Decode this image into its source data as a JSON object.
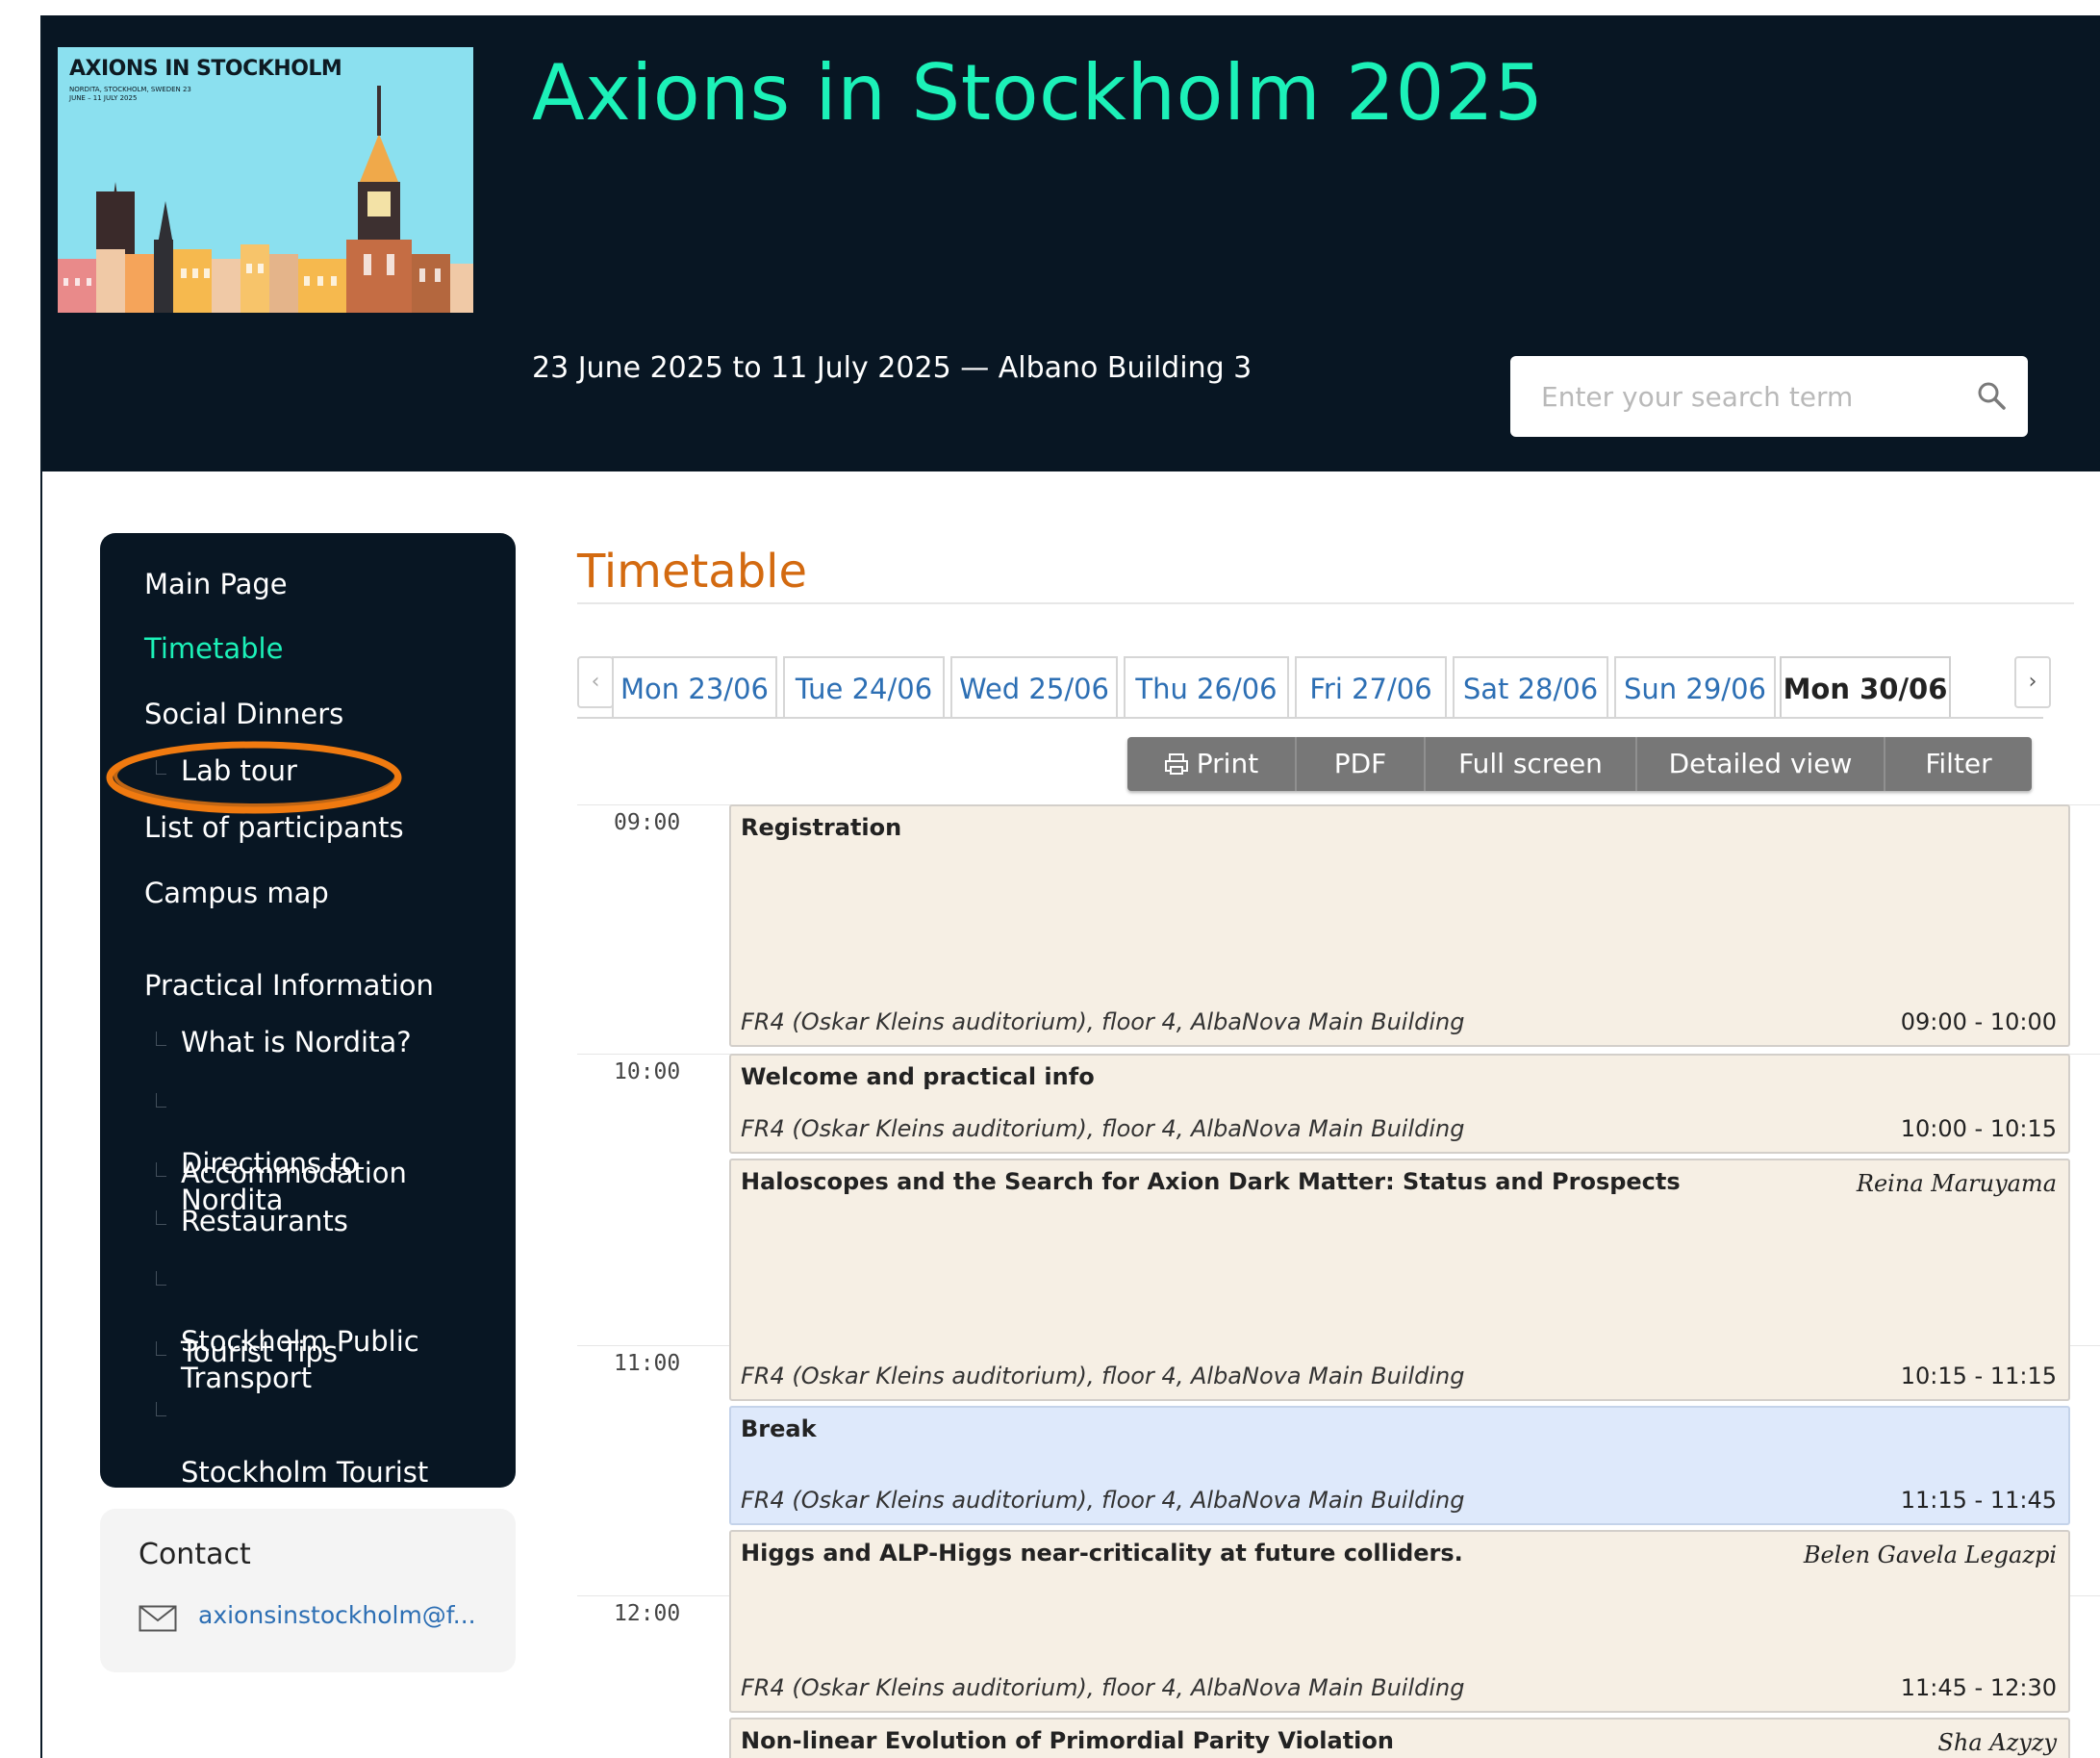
{
  "header": {
    "logo": {
      "title": "AXIONS IN STOCKHOLM",
      "subtitle": "NORDITA, STOCKHOLM, SWEDEN 23 JUNE – 11 JULY 2025"
    },
    "title": "Axions in Stockholm 2025",
    "dates": "23 June 2025 to 11 July 2025  —  Albano Building 3",
    "search_placeholder": "Enter your search term"
  },
  "sidebar": {
    "items": [
      {
        "label": "Main Page"
      },
      {
        "label": "Timetable",
        "active": true
      },
      {
        "label": "Social Dinners"
      },
      {
        "label": "Lab tour",
        "sub": true
      },
      {
        "label": "List of participants"
      },
      {
        "label": "Campus map"
      }
    ],
    "section": "Practical Information",
    "sub_items": [
      {
        "label": "What is Nordita?"
      },
      {
        "label": "Directions to\nNordita"
      },
      {
        "label": "Accommodation"
      },
      {
        "label": "Restaurants"
      },
      {
        "label": "Stockholm Public\nTransport"
      },
      {
        "label": "Tourist Tips"
      },
      {
        "label": "Stockholm Tourist\nInfo"
      }
    ]
  },
  "contact": {
    "title": "Contact",
    "email": "axionsinstockholm@f..."
  },
  "main": {
    "title": "Timetable",
    "prev_arrow": "‹",
    "next_arrow": "›",
    "day_tabs": [
      "Mon 23/06",
      "Tue 24/06",
      "Wed 25/06",
      "Thu 26/06",
      "Fri 27/06",
      "Sat 28/06",
      "Sun 29/06",
      "Mon 30/06"
    ],
    "selected_day": "Mon 30/06",
    "toolbar": {
      "print": "Print",
      "pdf": "PDF",
      "full_screen": "Full screen",
      "detailed_view": "Detailed view",
      "filter": "Filter"
    },
    "hours": [
      "09:00",
      "10:00",
      "11:00",
      "12:00"
    ],
    "entries": [
      {
        "title": "Registration",
        "speaker": "",
        "location": "FR4 (Oskar Kleins auditorium), floor 4, AlbaNova Main Building",
        "time": "09:00 - 10:00",
        "type": "session"
      },
      {
        "title": "Welcome and practical info",
        "speaker": "",
        "location": "FR4 (Oskar Kleins auditorium), floor 4, AlbaNova Main Building",
        "time": "10:00 - 10:15",
        "type": "session"
      },
      {
        "title": "Haloscopes and the Search for Axion Dark Matter: Status and Prospects",
        "speaker": "Reina Maruyama",
        "location": "FR4 (Oskar Kleins auditorium), floor 4, AlbaNova Main Building",
        "time": "10:15 - 11:15",
        "type": "session"
      },
      {
        "title": "Break",
        "speaker": "",
        "location": "FR4 (Oskar Kleins auditorium), floor 4, AlbaNova Main Building",
        "time": "11:15 - 11:45",
        "type": "break"
      },
      {
        "title": "Higgs and ALP-Higgs near-criticality at future colliders.",
        "speaker": "Belen Gavela Legazpi",
        "location": "FR4 (Oskar Kleins auditorium), floor 4, AlbaNova Main Building",
        "time": "11:45 - 12:30",
        "type": "session"
      },
      {
        "title": "Non-linear Evolution of Primordial Parity Violation",
        "speaker": "Sha Azyzy",
        "location": "",
        "time": "",
        "type": "session"
      }
    ]
  },
  "colors": {
    "header_bg": "#081623",
    "accent": "#1cf1b8",
    "page_title": "#d36a10",
    "link": "#2d6fb4",
    "entry_bg": "#f6efe4",
    "break_bg": "#dee9fb",
    "highlight": "#f07a10"
  }
}
